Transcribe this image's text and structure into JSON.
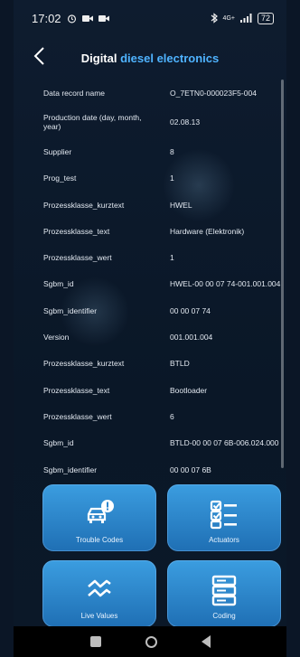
{
  "status_bar": {
    "time": "17:02",
    "right_text": "4G+",
    "battery": "72"
  },
  "header": {
    "title_part1": "Digital",
    "title_part2": "diesel electronics"
  },
  "records": [
    {
      "label": "Data record name",
      "value": "O_7ETN0-000023F5-004"
    },
    {
      "label": "Production date (day, month, year)",
      "value": "02.08.13"
    },
    {
      "label": "Supplier",
      "value": "8"
    },
    {
      "label": "Prog_test",
      "value": "1"
    },
    {
      "label": "Prozessklasse_kurztext",
      "value": "HWEL"
    },
    {
      "label": "Prozessklasse_text",
      "value": "Hardware (Elektronik)"
    },
    {
      "label": "Prozessklasse_wert",
      "value": "1"
    },
    {
      "label": "Sgbm_id",
      "value": "HWEL-00 00 07 74-001.001.004"
    },
    {
      "label": "Sgbm_identifier",
      "value": "00 00 07 74"
    },
    {
      "label": "Version",
      "value": "001.001.004"
    },
    {
      "label": "Prozessklasse_kurztext",
      "value": "BTLD"
    },
    {
      "label": "Prozessklasse_text",
      "value": "Bootloader"
    },
    {
      "label": "Prozessklasse_wert",
      "value": "6"
    },
    {
      "label": "Sgbm_id",
      "value": "BTLD-00 00 07 6B-006.024.000"
    },
    {
      "label": "Sgbm_identifier",
      "value": "00 00 07 6B"
    }
  ],
  "tiles": [
    {
      "label": "Trouble Codes",
      "icon": "car-alert-icon"
    },
    {
      "label": "Actuators",
      "icon": "checklist-icon"
    },
    {
      "label": "Live Values",
      "icon": "wave-chart-icon"
    },
    {
      "label": "Coding",
      "icon": "coding-list-icon"
    }
  ],
  "colors": {
    "accent": "#4fb3ff",
    "tile": "#2d86cf",
    "background": "#0e1c2f"
  }
}
